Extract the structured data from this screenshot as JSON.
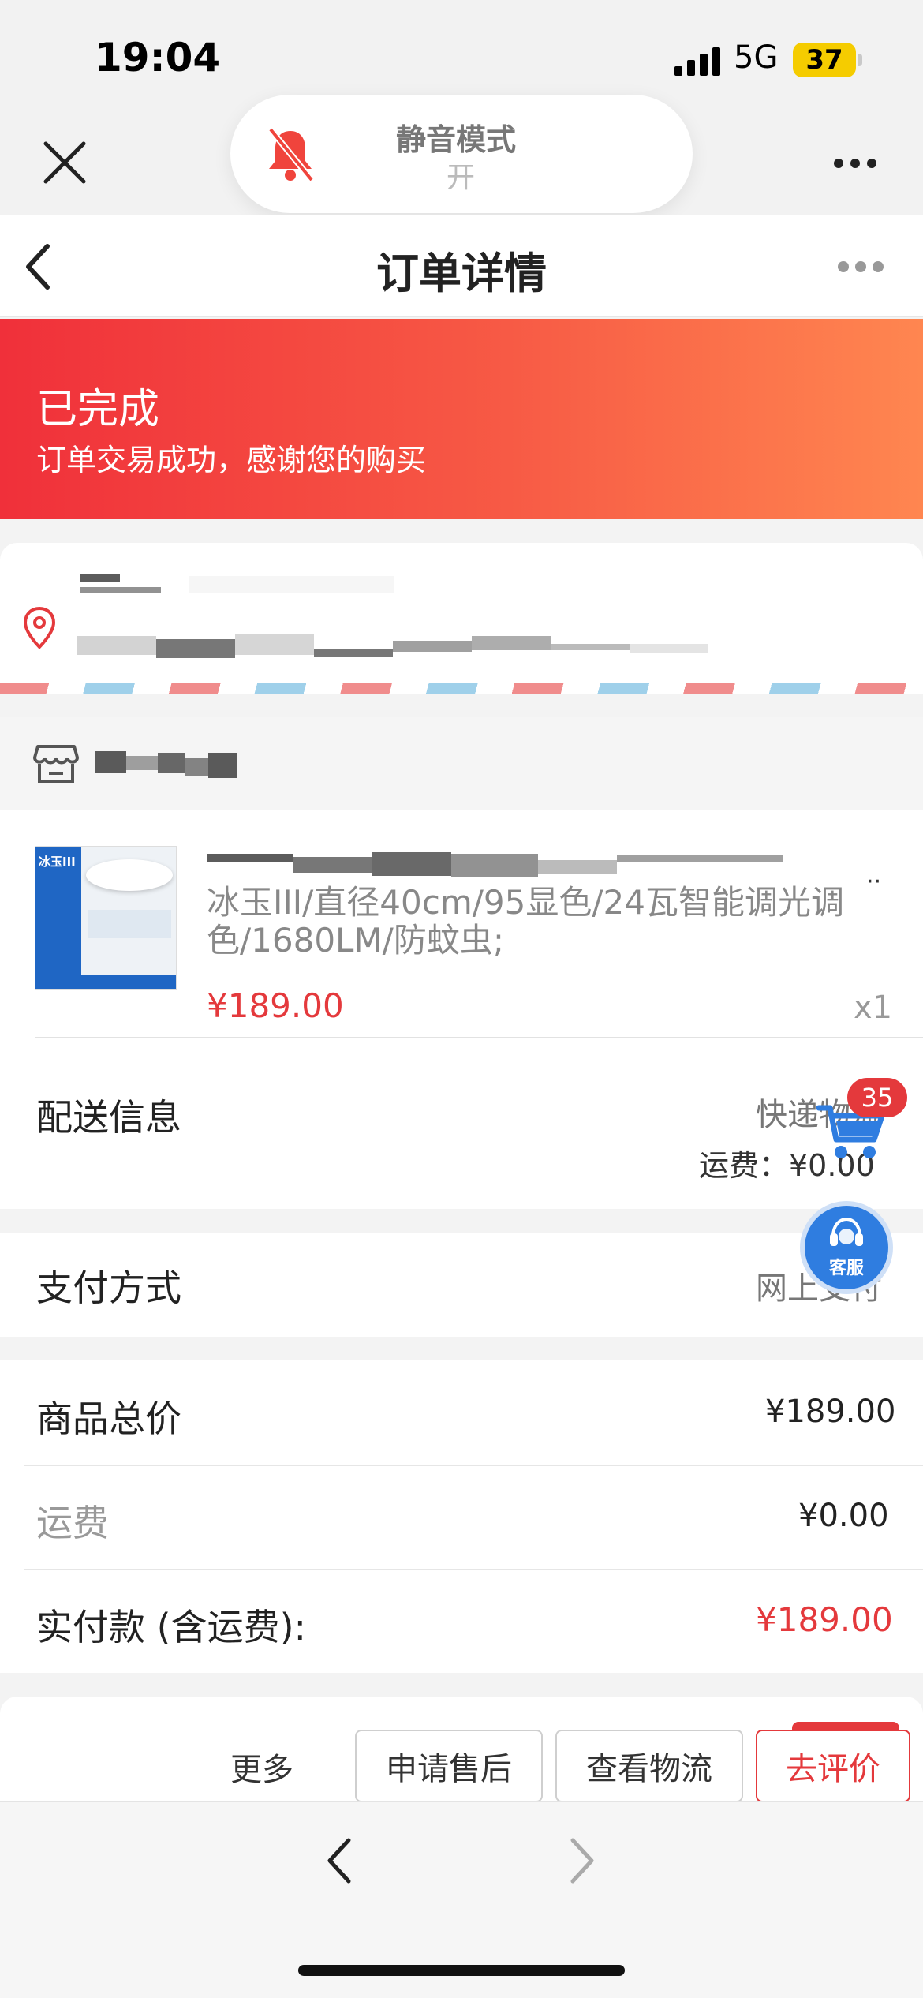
{
  "status_bar": {
    "time": "19:04",
    "network": "5G",
    "battery": "37"
  },
  "silent_mode": {
    "title": "静音模式",
    "state": "开"
  },
  "nav": {
    "title": "订单详情"
  },
  "order_status": {
    "title": "已完成",
    "subtitle": "订单交易成功，感谢您的购买"
  },
  "product": {
    "spec": "冰玉III/直径40cm/95显色/24瓦智能调光调色/1680LM/防蚊虫;",
    "price": "¥189.00",
    "quantity": "x1",
    "image_caption": "冰玉III"
  },
  "delivery": {
    "label": "配送信息",
    "method": "快递物流",
    "shipping_line": "运费：¥0.00"
  },
  "payment": {
    "label": "支付方式",
    "value": "网上支付"
  },
  "totals": {
    "subtotal_label": "商品总价",
    "subtotal_value": "¥189.00",
    "freight_label": "运费",
    "freight_value": "¥0.00",
    "paid_label": "实付款 (含运费):",
    "paid_value": "¥189.00"
  },
  "actions": {
    "more": "更多",
    "after_sale": "申请售后",
    "logistics": "查看物流",
    "review": "去评价"
  },
  "floating": {
    "cart_badge": "35",
    "service": "客服"
  },
  "colors": {
    "accent": "#e4393c",
    "banner_start": "#f0303a",
    "banner_end": "#ff8650",
    "service_blue": "#2f7de0"
  }
}
